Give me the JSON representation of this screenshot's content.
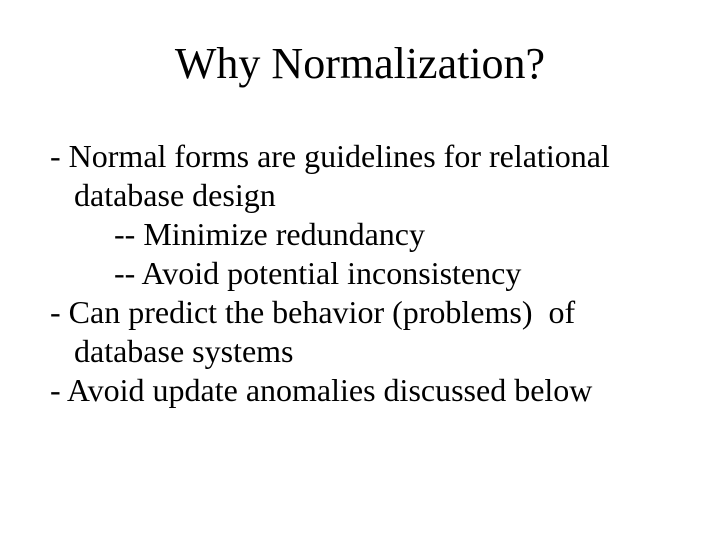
{
  "slide": {
    "title": "Why Normalization?",
    "lines": {
      "l1": "- Normal forms are guidelines for relational",
      "l2": "   database design",
      "l3": "        -- Minimize redundancy",
      "l4": "        -- Avoid potential inconsistency",
      "l5": "- Can predict the behavior (problems)  of",
      "l6": "   database systems",
      "l7": "- Avoid update anomalies discussed below"
    }
  }
}
